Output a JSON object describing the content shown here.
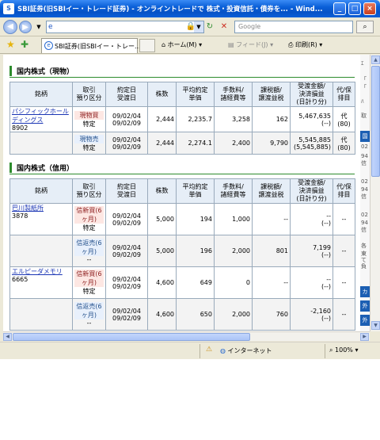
{
  "window": {
    "title": "SBI証券(旧SBIイー・トレード証券) - オンライントレードで 株式・投資信託・債券を... - Wind...",
    "icon": "S",
    "btn_min": "_",
    "btn_max": "□",
    "btn_close": "×"
  },
  "address": {
    "search_placeholder": "Google"
  },
  "tabbar": {
    "tab_title": "SBI証券(旧SBIイー・トレー...",
    "home": "ホーム(M)",
    "feed": "フィード(J)",
    "print": "印刷(R)"
  },
  "spot": {
    "heading": "国内株式（現物）",
    "headers": [
      "銘柄",
      "取引\n預り区分",
      "約定日\n受渡日",
      "株数",
      "平均約定\n単価",
      "手数料/\n諸経費等",
      "課税額/\n譲渡益税",
      "受渡金額/\n決済損益\n(日計り分)",
      "代/保\n排目"
    ],
    "rows": [
      {
        "name": "パシフィックホールディングス",
        "code": "8902",
        "type": "現物買",
        "account": "特定",
        "dates": [
          "09/02/04",
          "09/02/09"
        ],
        "shares": "2,444",
        "price": "2,235.7",
        "fee": "3,258",
        "tax": "162",
        "amount": [
          "5,467,635",
          "(--)"
        ],
        "misc": [
          "代",
          "(80)"
        ]
      },
      {
        "name": "",
        "code": "",
        "type": "現物売",
        "account": "特定",
        "dates": [
          "09/02/04",
          "09/02/09"
        ],
        "shares": "2,444",
        "price": "2,274.1",
        "fee": "2,400",
        "tax": "9,790",
        "amount": [
          "5,545,885",
          "(5,545,885)"
        ],
        "misc": [
          "代",
          "(80)"
        ]
      }
    ]
  },
  "margin": {
    "heading": "国内株式（信用）",
    "headers": [
      "銘柄",
      "取引\n預り区分",
      "約定日\n受渡日",
      "株数",
      "平均約定\n単価",
      "手数料/\n諸経費等",
      "課税額/\n譲渡益税",
      "受渡金額/\n決済損益\n(日計り分)",
      "代/保\n排目"
    ],
    "rows": [
      {
        "name": "巴川製紙所",
        "code": "3878",
        "type": "信新買(6ヶ月)",
        "account": "特定",
        "dates": [
          "09/02/04",
          "09/02/09"
        ],
        "shares": "5,000",
        "price": "194",
        "fee": "1,000",
        "tax": "--",
        "amount": [
          "--",
          "(--)"
        ],
        "misc": [
          "--",
          ""
        ]
      },
      {
        "name": "",
        "code": "",
        "type": "信返売(6ヶ月)",
        "account": "--",
        "dates": [
          "09/02/04",
          "09/02/09"
        ],
        "shares": "5,000",
        "price": "196",
        "fee": "2,000",
        "tax": "801",
        "amount": [
          "7,199",
          "(--)"
        ],
        "misc": [
          "--",
          ""
        ]
      },
      {
        "name": "エルピーダメモリ",
        "code": "6665",
        "type": "信新買(6ヶ月)",
        "account": "特定",
        "dates": [
          "09/02/04",
          "09/02/09"
        ],
        "shares": "4,600",
        "price": "649",
        "fee": "0",
        "tax": "--",
        "amount": [
          "--",
          "(--)"
        ],
        "misc": [
          "--",
          ""
        ]
      },
      {
        "name": "",
        "code": "",
        "type": "信返売(6ヶ月)",
        "account": "--",
        "dates": [
          "09/02/04",
          "09/02/09"
        ],
        "shares": "4,600",
        "price": "650",
        "fee": "2,000",
        "tax": "760",
        "amount": [
          "-2,160",
          "(--)"
        ],
        "misc": [
          "--",
          ""
        ]
      }
    ]
  },
  "rightpanel": {
    "texts": [
      "ｴ",
      "「",
      "「",
      "ﾊ",
      "取",
      "02",
      "94",
      "信",
      "02",
      "94",
      "信",
      "02",
      "94",
      "信",
      "各",
      "東",
      "て",
      "負"
    ],
    "buttons": [
      "国",
      "カ",
      "外",
      "外"
    ]
  },
  "status": {
    "zone": "インターネット",
    "zoom": "100%"
  }
}
